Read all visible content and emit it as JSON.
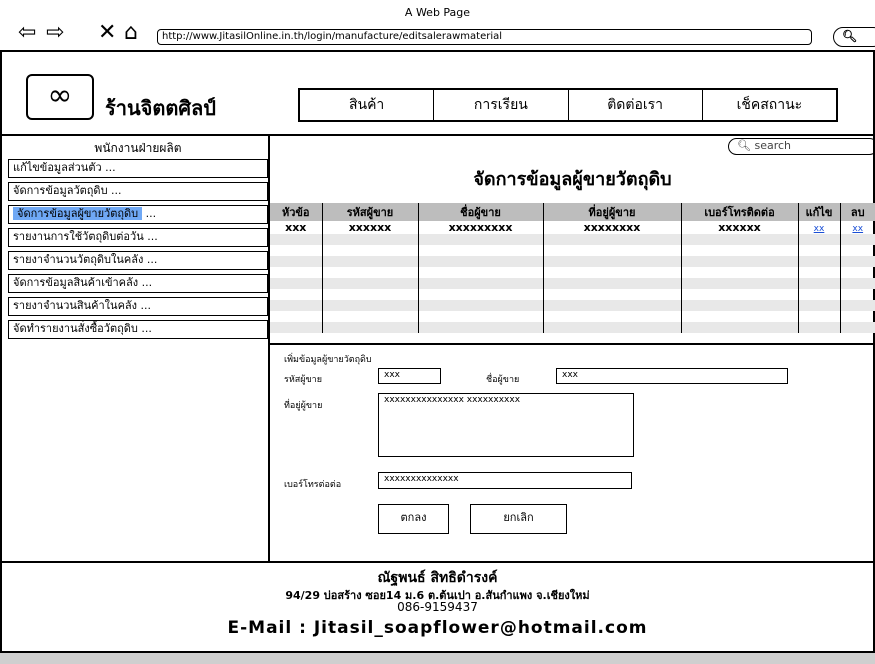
{
  "window": {
    "title": "A Web Page",
    "url": "http://www.JitasilOnline.in.th/login/manufacture/editsalerawmaterial"
  },
  "icons": {
    "back": "back-arrow-icon",
    "forward": "forward-arrow-icon",
    "stop": "close-icon",
    "home": "home-icon",
    "search": "search-icon",
    "logo": "infinity-icon"
  },
  "header": {
    "brand": "ร้านจิตตศิลป์"
  },
  "menu": [
    {
      "label": "สินค้า"
    },
    {
      "label": "การเรียน"
    },
    {
      "label": "ติดต่อเรา"
    },
    {
      "label": "เช็คสถานะ"
    }
  ],
  "sidebar": {
    "title": "พนักงานฝ่ายผลิต",
    "items": [
      {
        "label": "แก้ไขข้อมูลส่วนตัว   ..."
      },
      {
        "label": "จัดการข้อมูลวัตถุดิบ   ..."
      },
      {
        "label": "จัดการข้อมูลผู้ขายวัตถุดิบ",
        "suffix": "..."
      },
      {
        "label": "รายงานการใช้วัตถุดิบต่อวัน   ..."
      },
      {
        "label": "รายงาจำนวนวัตถุดิบในคลัง   ..."
      },
      {
        "label": "จัดการข้อมูลสินค้าเข้าคลัง   ..."
      },
      {
        "label": "รายงาจำนวนสินค้าในคลัง   ..."
      },
      {
        "label": "จัดทำรายงานสั่งซื้อวัตถุดิบ   ..."
      }
    ]
  },
  "search": {
    "placeholder": "search"
  },
  "main": {
    "title": "จัดการข้อมูลผู้ขายวัตถุดิบ",
    "table": {
      "headers": [
        "หัวข้อ",
        "รหัสผู้ขาย",
        "ชื่อผู้ขาย",
        "ที่อยู่ผู้ขาย",
        "เบอร์โทรติดต่อ",
        "แก้ไข",
        "ลบ"
      ],
      "row": [
        "xxx",
        "xxxxxx",
        "xxxxxxxxx",
        "xxxxxxxx",
        "xxxxxx",
        "xx",
        "xx"
      ]
    }
  },
  "form": {
    "heading": "เพิ่มข้อมูลผู้ขายวัตถุดิบ",
    "code_label": "รหัสผู้ขาย",
    "code_value": "xxx",
    "name_label": "ชื่อผู้ขาย",
    "name_value": "xxx",
    "address_label": "ที่อยู่ผู้ขาย",
    "address_value": "xxxxxxxxxxxxxxx xxxxxxxxxx",
    "phone_label": "เบอร์โทรต่อต่อ",
    "phone_value": "xxxxxxxxxxxxxx",
    "ok_label": "ตกลง",
    "cancel_label": "ยกเลิก"
  },
  "footer": {
    "name": "ณัฐพนธ์ สิทธิดำรงค์",
    "address": "94/29 บ่อสร้าง ซอย14  ม.6 ต.ต้นเปา อ.สันกำแพง จ.เชียงใหม่",
    "phone": "086-9159437",
    "email": "E-Mail : Jitasil_soapflower@hotmail.com"
  }
}
